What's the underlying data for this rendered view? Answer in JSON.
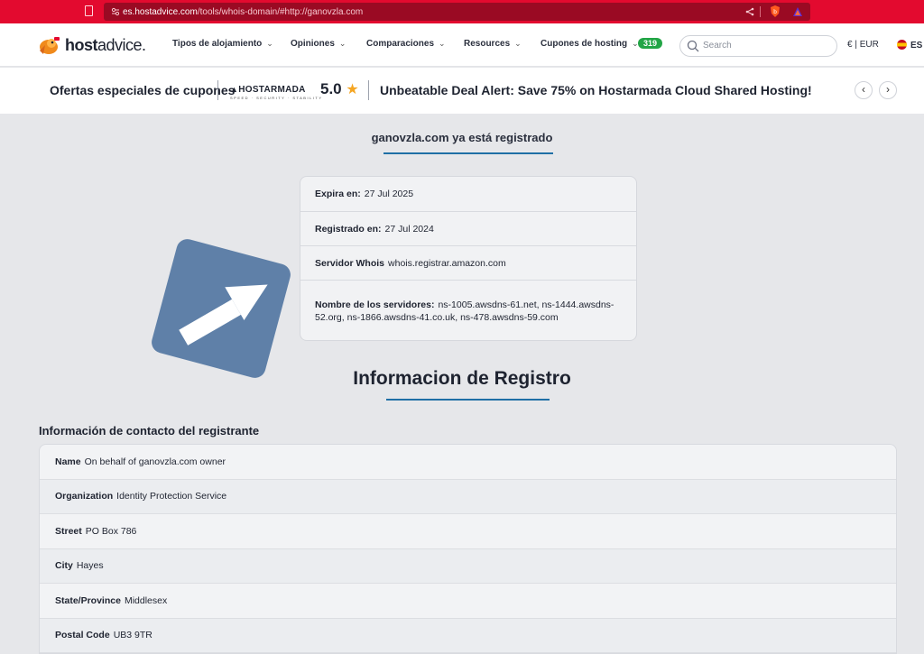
{
  "browser": {
    "url_host": "es.hostadvice.com",
    "url_path": "/tools/whois-domain/#http://ganovzla.com"
  },
  "header": {
    "logo_bold": "host",
    "logo_rest": "advice.",
    "nav": [
      {
        "label": "Tipos de alojamiento"
      },
      {
        "label": "Opiniones"
      },
      {
        "label": "Comparaciones"
      },
      {
        "label": "Resources"
      },
      {
        "label": "Cupones de hosting"
      }
    ],
    "coupons_count": "319",
    "search_placeholder": "Search",
    "currency": "€ | EUR",
    "language": "ES"
  },
  "promo": {
    "title": "Ofertas especiales de cupones",
    "brand": "HOSTARMADA",
    "brand_tagline": "SPEED · SECURITY · STABILITY",
    "rating": "5.0",
    "deal_text": "Unbeatable Deal Alert: Save 75% on Hostarmada Cloud Shared Hosting!"
  },
  "whois": {
    "registered_title": "ganovzla.com ya está registrado",
    "summary": [
      {
        "label": "Expira en:",
        "value": "27 Jul 2025"
      },
      {
        "label": "Registrado en:",
        "value": "27 Jul 2024"
      },
      {
        "label": "Servidor Whois",
        "value": "whois.registrar.amazon.com"
      },
      {
        "label": "Nombre de los servidores:",
        "value": "ns-1005.awsdns-61.net, ns-1444.awsdns-52.org, ns-1866.awsdns-41.co.uk, ns-478.awsdns-59.com"
      }
    ],
    "section_title": "Informacion de Registro",
    "contact_title": "Información de contacto del registrante",
    "contact": [
      {
        "label": "Name",
        "value": "On behalf of ganovzla.com owner"
      },
      {
        "label": "Organization",
        "value": "Identity Protection Service"
      },
      {
        "label": "Street",
        "value": "PO Box 786"
      },
      {
        "label": "City",
        "value": "Hayes"
      },
      {
        "label": "State/Province",
        "value": "Middlesex"
      },
      {
        "label": "Postal Code",
        "value": "UB3 9TR"
      }
    ]
  },
  "colors": {
    "browser_red": "#e30a2f",
    "accent_blue": "#1f6fa6",
    "badge_green": "#22a546",
    "star_orange": "#f5a623"
  }
}
